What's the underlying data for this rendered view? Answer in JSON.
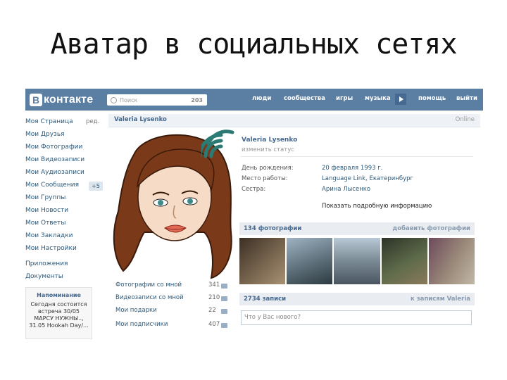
{
  "slide": {
    "title": "Аватар в социальных сетях"
  },
  "vk": {
    "topbar": {
      "logo_letter": "B",
      "logo_text": "контакте",
      "search_placeholder": "Поиск",
      "search_count": "203",
      "nav": [
        "люди",
        "сообщества",
        "игры",
        "музыка",
        "помощь",
        "выйти"
      ]
    },
    "menu": {
      "items": [
        "Моя Страница",
        "Мои Друзья",
        "Мои Фотографии",
        "Мои Видеозаписи",
        "Мои Аудиозаписи",
        "Мои Сообщения",
        "Мои Группы",
        "Мои Новости",
        "Мои Ответы",
        "Мои Закладки",
        "Мои Настройки"
      ],
      "edit": "ред.",
      "messages_badge": "+5",
      "extra": [
        "Приложения",
        "Документы"
      ]
    },
    "reminder": {
      "title": "Напоминание",
      "lines": [
        "Сегодня состоится",
        "встреча 30/05",
        "МАРСУ НУЖНЫ..,",
        "31.05 Hookah Day/..."
      ]
    },
    "profile": {
      "bar_name": "Valeria Lysenko",
      "online": "Online",
      "name": "Valeria Lysenko",
      "status": "изменить статус",
      "info": [
        {
          "label": "День рождения:",
          "value": "20 февраля 1993 г."
        },
        {
          "label": "Место работы:",
          "value": "Language Link, Екатеринбург"
        },
        {
          "label": "Сестра:",
          "value": "Арина Лысенко"
        }
      ],
      "more": "Показать подробную информацию"
    },
    "photos_bar": {
      "left": "134 фотографии",
      "right": "добавить фотографии"
    },
    "photo_colors": [
      "#5a4a3a",
      "#6b7f8c",
      "#8fa3b5",
      "#3f4a3c",
      "#7a5a6a"
    ],
    "stats": [
      {
        "label": "Фотографии со мной",
        "value": "341"
      },
      {
        "label": "Видеозаписи со мной",
        "value": "210"
      },
      {
        "label": "Мои подарки",
        "value": "22"
      },
      {
        "label": "Мои подписчики",
        "value": "407"
      }
    ],
    "wall_bar": {
      "left": "2734 записи",
      "right": "к записям Valeria"
    },
    "wall_placeholder": "Что у Вас нового?"
  }
}
